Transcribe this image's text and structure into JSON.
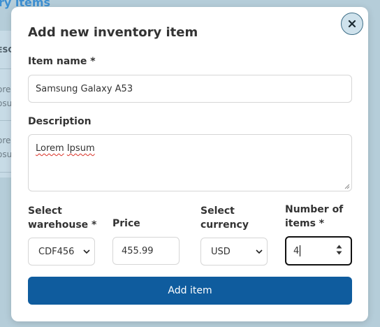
{
  "background": {
    "page_title": "ry items",
    "column_header": "ESC",
    "rows": [
      [
        "ore",
        "osu"
      ],
      [
        "ore",
        "osu"
      ]
    ]
  },
  "modal": {
    "title": "Add new inventory item",
    "close_icon": "close-icon",
    "fields": {
      "item_name": {
        "label": "Item name *",
        "value": "Samsung Galaxy A53"
      },
      "description": {
        "label": "Description",
        "value_word1": "Lorem",
        "value_word2": "Ipsum"
      },
      "warehouse": {
        "label": "Select warehouse *",
        "selected": "CDF456"
      },
      "price": {
        "label": "Price",
        "value": "455.99"
      },
      "currency": {
        "label": "Select currency",
        "selected": "USD"
      },
      "number_of_items": {
        "label": "Number of items *",
        "value": "4"
      }
    },
    "submit_label": "Add item"
  },
  "colors": {
    "primary": "#0f5c9e",
    "overlay": "#b5cdd9",
    "close_bg": "#cfe2ec",
    "background_link": "#3d8fd1"
  }
}
